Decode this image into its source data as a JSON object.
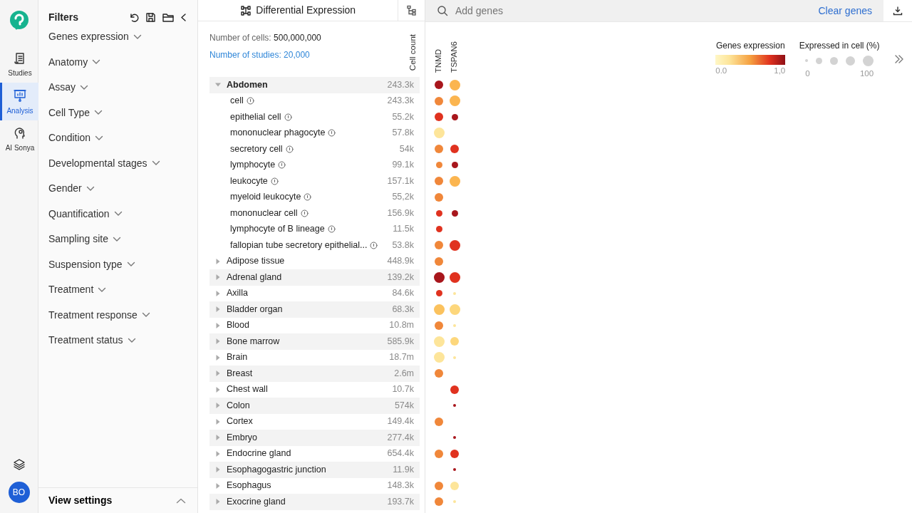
{
  "rail": {
    "items": [
      {
        "label": "Studies",
        "selected": false
      },
      {
        "label": "Analysis",
        "selected": true
      },
      {
        "label": "AI Sonya",
        "selected": false
      }
    ],
    "avatar": "BO"
  },
  "filters": {
    "title": "Filters",
    "items": [
      "Genes expression",
      "Anatomy",
      "Assay",
      "Cell Type",
      "Condition",
      "Developmental stages",
      "Gender",
      "Quantification",
      "Sampling site",
      "Suspension type",
      "Treatment",
      "Treatment response",
      "Treatment status"
    ],
    "footer": "View settings"
  },
  "panel": {
    "title": "Differential Expression",
    "cells_label": "Number of cells:",
    "cells_value": "500,000,000",
    "studies_link": "Number of studies: 20,000",
    "count_header": "Cell count"
  },
  "search": {
    "placeholder": "Add genes",
    "clear": "Clear genes"
  },
  "genes": [
    "TNMD",
    "TSPAN6"
  ],
  "legend": {
    "expression_title": "Genes expression",
    "expression_min": "0.0",
    "expression_max": "1,0",
    "percent_title": "Expressed in cell (%)",
    "percent_min": "0",
    "percent_max": "100"
  },
  "tree": [
    {
      "label": "Abdomen",
      "count": "243.3k",
      "expanded": true,
      "dot_1": {
        "color": "#a8161c",
        "kind": "medium"
      },
      "dot_2": {
        "color": "#fbb550",
        "kind": "large"
      },
      "children": [
        {
          "label": "cell",
          "count": "243.3k",
          "dot_1": {
            "color": "#f0873a",
            "kind": "medium"
          },
          "dot_2": {
            "color": "#fbb550",
            "kind": "large"
          }
        },
        {
          "label": "epithelial cell",
          "count": "55.2k",
          "dot_1": {
            "color": "#e0321f",
            "kind": "medium"
          },
          "dot_2": {
            "color": "#a8161c",
            "kind": "small"
          }
        },
        {
          "label": "mononuclear phagocyte",
          "count": "57.8k",
          "dot_1": {
            "color": "#fde59a",
            "kind": "large"
          }
        },
        {
          "label": "secretory cell",
          "count": "54k",
          "dot_1": {
            "color": "#f0873a",
            "kind": "medium"
          },
          "dot_2": {
            "color": "#e0321f",
            "kind": "medium"
          }
        },
        {
          "label": "lymphocyte",
          "count": "99.1k",
          "dot_1": {
            "color": "#f0873a",
            "kind": "small"
          },
          "dot_2": {
            "color": "#a8161c",
            "kind": "small"
          }
        },
        {
          "label": "leukocyte",
          "count": "157.1k",
          "dot_1": {
            "color": "#f0873a",
            "kind": "medium"
          },
          "dot_2": {
            "color": "#fbb550",
            "kind": "large"
          }
        },
        {
          "label": "myeloid leukocyte",
          "count": "55,2k",
          "dot_1": {
            "color": "#f0873a",
            "kind": "medium"
          }
        },
        {
          "label": "mononuclear cell",
          "count": "156.9k",
          "dot_1": {
            "color": "#e0321f",
            "kind": "small"
          },
          "dot_2": {
            "color": "#a8161c",
            "kind": "small"
          }
        },
        {
          "label": "lymphocyte of B lineage",
          "count": "11.5k",
          "dot_1": {
            "color": "#e0321f",
            "kind": "small"
          }
        },
        {
          "label": "fallopian tube secretory epithelial...",
          "count": "53.8k",
          "dot_1": {
            "color": "#f0873a",
            "kind": "medium"
          },
          "dot_2": {
            "color": "#e0321f",
            "kind": "large"
          }
        }
      ]
    },
    {
      "label": "Adipose tissue",
      "count": "448.9k",
      "expanded": false,
      "dot_1": {
        "color": "#f0873a",
        "kind": "medium"
      }
    },
    {
      "label": "Adrenal gland",
      "count": "139.2k",
      "expanded": false,
      "dot_1": {
        "color": "#a8161c",
        "kind": "large"
      },
      "dot_2": {
        "color": "#e0321f",
        "kind": "large"
      }
    },
    {
      "label": "Axilla",
      "count": "84.6k",
      "expanded": false,
      "dot_1": {
        "color": "#e0321f",
        "kind": "small"
      },
      "dot_2": {
        "color": "#fde59a",
        "kind": "tiny"
      }
    },
    {
      "label": "Bladder organ",
      "count": "68.3k",
      "expanded": false,
      "dot_1": {
        "color": "#fbc25e",
        "kind": "large"
      },
      "dot_2": {
        "color": "#fdd77c",
        "kind": "large"
      }
    },
    {
      "label": "Blood",
      "count": "10.8m",
      "expanded": false,
      "dot_1": {
        "color": "#f0873a",
        "kind": "medium"
      },
      "dot_2": {
        "color": "#fde59a",
        "kind": "tiny"
      }
    },
    {
      "label": "Bone marrow",
      "count": "585.9k",
      "expanded": false,
      "dot_1": {
        "color": "#fde59a",
        "kind": "large"
      },
      "dot_2": {
        "color": "#fdd77c",
        "kind": "medium"
      }
    },
    {
      "label": "Brain",
      "count": "18.7m",
      "expanded": false,
      "dot_1": {
        "color": "#fde59a",
        "kind": "large"
      },
      "dot_2": {
        "color": "#fde59a",
        "kind": "tiny"
      }
    },
    {
      "label": "Breast",
      "count": "2.6m",
      "expanded": false,
      "dot_1": {
        "color": "#f0873a",
        "kind": "medium"
      }
    },
    {
      "label": "Chest wall",
      "count": "10.7k",
      "expanded": false,
      "dot_2": {
        "color": "#e0321f",
        "kind": "medium"
      }
    },
    {
      "label": "Colon",
      "count": "574k",
      "expanded": false,
      "dot_2": {
        "color": "#a8161c",
        "kind": "tiny"
      }
    },
    {
      "label": "Cortex",
      "count": "149.4k",
      "expanded": false,
      "dot_1": {
        "color": "#f0873a",
        "kind": "medium"
      }
    },
    {
      "label": "Embryo",
      "count": "277.4k",
      "expanded": false,
      "dot_2": {
        "color": "#a8161c",
        "kind": "tiny"
      }
    },
    {
      "label": "Endocrine gland",
      "count": "654.4k",
      "expanded": false,
      "dot_1": {
        "color": "#f0873a",
        "kind": "medium"
      },
      "dot_2": {
        "color": "#e0321f",
        "kind": "medium"
      }
    },
    {
      "label": "Esophagogastric junction",
      "count": "11.9k",
      "expanded": false,
      "dot_2": {
        "color": "#a8161c",
        "kind": "tiny"
      }
    },
    {
      "label": "Esophagus",
      "count": "148.3k",
      "expanded": false,
      "dot_1": {
        "color": "#f0873a",
        "kind": "medium"
      },
      "dot_2": {
        "color": "#fde59a",
        "kind": "medium"
      }
    },
    {
      "label": "Exocrine gland",
      "count": "193.7k",
      "expanded": false,
      "dot_1": {
        "color": "#f0873a",
        "kind": "medium"
      },
      "dot_2": {
        "color": "#fde59a",
        "kind": "tiny"
      }
    }
  ]
}
